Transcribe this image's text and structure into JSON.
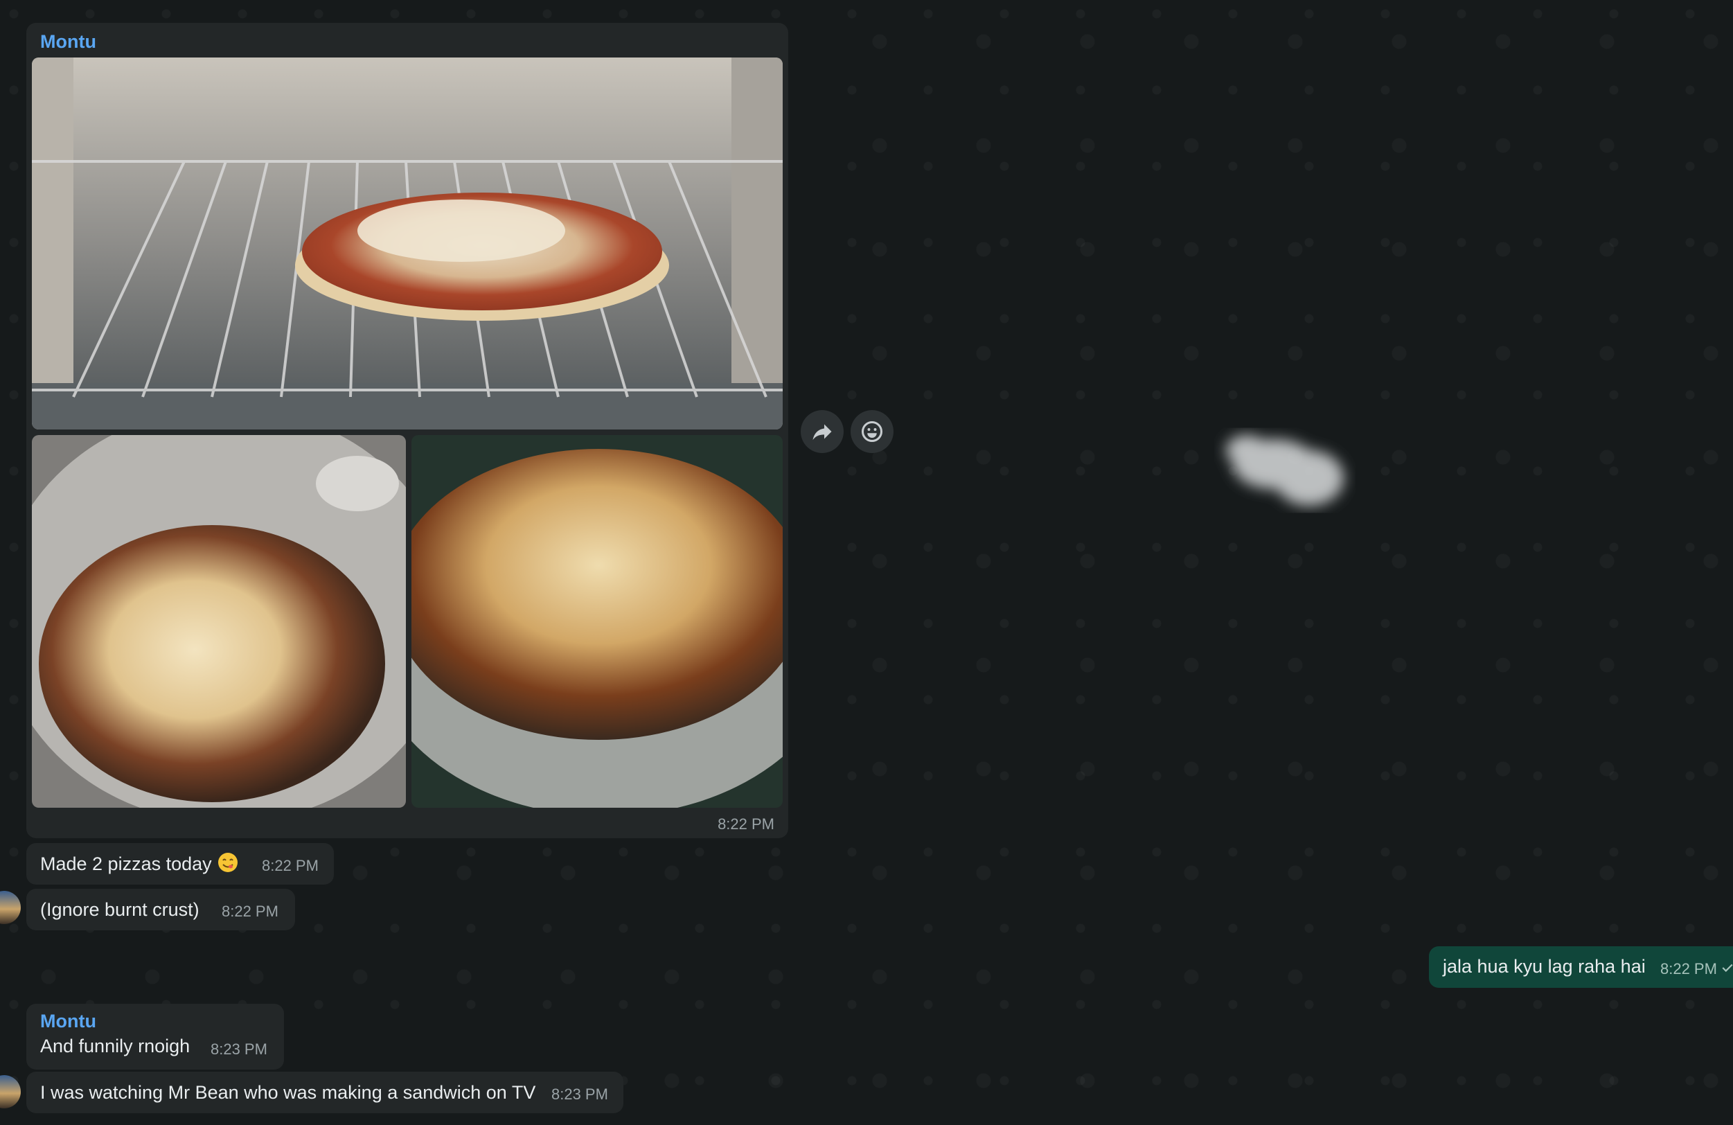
{
  "chat": {
    "album": {
      "sender": "Montu",
      "time": "8:22 PM"
    },
    "messages": [
      {
        "text": "Made 2 pizzas today",
        "emoji": "yum-face",
        "time": "8:22 PM"
      },
      {
        "text": "(Ignore burnt crust)",
        "time": "8:22 PM"
      },
      {
        "text": "jala hua kyu lag raha hai",
        "time": "8:22 PM",
        "status": "sent-check-icon"
      },
      {
        "sender": "Montu",
        "text": "And funnily rnoigh",
        "time": "8:23 PM"
      },
      {
        "text": "I was watching Mr Bean who was making a sandwich on TV",
        "time": "8:23 PM"
      }
    ]
  },
  "icons": [
    "forward-icon",
    "emoji-reaction-icon",
    "read-check-icon",
    "yum-face"
  ],
  "colors": {
    "incoming_bubble": "#232728",
    "outgoing_bubble": "#10463a",
    "sender_name": "#5aa6f2",
    "wallpaper": "#161a1b"
  }
}
